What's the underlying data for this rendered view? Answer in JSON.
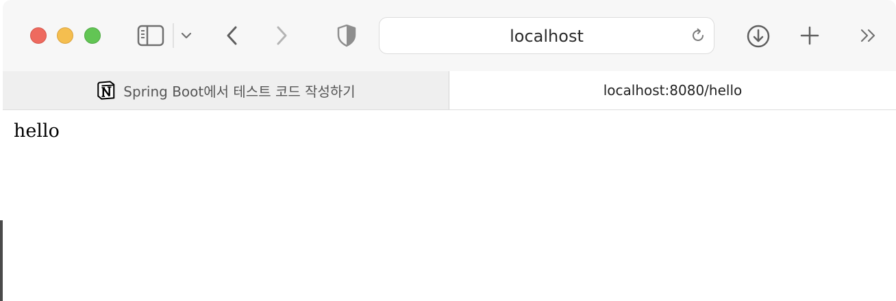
{
  "window": {
    "traffic_lights": [
      "close",
      "minimize",
      "zoom"
    ]
  },
  "toolbar": {
    "icons": [
      "sidebar-icon",
      "chevron-down-icon",
      "back-icon",
      "forward-icon",
      "privacy-shield-icon",
      "reload-icon",
      "download-icon",
      "new-tab-icon",
      "more-chevrons-icon"
    ],
    "address": "localhost"
  },
  "tabs": [
    {
      "label": "Spring Boot에서 테스트 코드 작성하기",
      "icon": "notion-icon",
      "active": false
    },
    {
      "label": "localhost:8080/hello",
      "active": true
    }
  ],
  "page": {
    "body_text": "hello"
  }
}
